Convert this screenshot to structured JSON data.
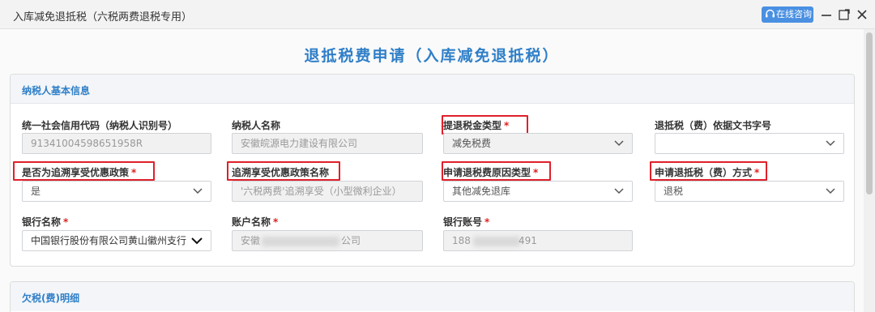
{
  "window": {
    "title": "入库减免退抵税（六税两费退税专用）",
    "consult_label": "在线咨询"
  },
  "page": {
    "title": "退抵税费申请（入库减免退抵税）"
  },
  "taxpayer_section": {
    "title": "纳税人基本信息",
    "fields": {
      "credit_code": {
        "label": "统一社会信用代码（纳税人识别号）",
        "value": "91341004598651958R"
      },
      "taxpayer_name": {
        "label": "纳税人名称",
        "value": "安徽皖源电力建设有限公司"
      },
      "refund_type": {
        "label": "提退税金类型",
        "required": "*",
        "value": "减免税费"
      },
      "doc_number": {
        "label": "退抵税（费）依据文书字号",
        "value": ""
      },
      "retro_policy": {
        "label": "是否为追溯享受优惠政策",
        "required": "*",
        "value": "是"
      },
      "retro_policy_name": {
        "label": "追溯享受优惠政策名称",
        "value": "'六税两费'追溯享受（小型微利企业）"
      },
      "refund_reason": {
        "label": "申请退税费原因类型",
        "required": "*",
        "value": "其他减免退库"
      },
      "refund_method": {
        "label": "申请退抵税（费）方式",
        "required": "*",
        "value": "退税"
      },
      "bank_name": {
        "label": "银行名称",
        "required": "*",
        "value": "中国银行股份有限公司黄山徽州支行"
      },
      "account_name": {
        "label": "账户名称",
        "required": "*",
        "value_prefix": "安徽",
        "value_suffix": "公司"
      },
      "account_number": {
        "label": "银行账号",
        "required": "*",
        "value_prefix": "188",
        "value_suffix": "491"
      }
    }
  },
  "arrears_section": {
    "title": "欠税(费)明细"
  },
  "colors": {
    "accent": "#2f7fc8",
    "required": "#e02020",
    "highlight_box": "#e0202a",
    "consult_button": "#4a90e2"
  },
  "icons": [
    "headset-icon",
    "minimize-icon",
    "maximize-icon",
    "close-icon",
    "chevron-down-icon"
  ]
}
